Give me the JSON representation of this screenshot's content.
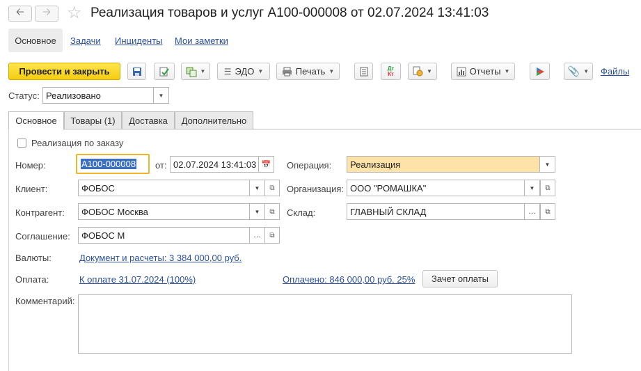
{
  "window": {
    "title": "Реализация товаров и услуг А100-000008 от 02.07.2024 13:41:03"
  },
  "top_nav": {
    "items": [
      {
        "label": "Основное",
        "active": true
      },
      {
        "label": "Задачи"
      },
      {
        "label": "Инциденты"
      },
      {
        "label": "Мои заметки"
      }
    ]
  },
  "toolbar": {
    "post_close": "Провести и закрыть",
    "edo": "ЭДО",
    "print": "Печать",
    "reports": "Отчеты",
    "files": "Файлы",
    "dt_kt_top": "Дт",
    "dt_kt_bottom": "Кт"
  },
  "status": {
    "label": "Статус:",
    "value": "Реализовано"
  },
  "tabs": [
    {
      "label": "Основное",
      "active": true
    },
    {
      "label": "Товары (1)"
    },
    {
      "label": "Доставка"
    },
    {
      "label": "Дополнительно"
    }
  ],
  "form": {
    "by_order_label": "Реализация по заказу",
    "by_order_checked": false,
    "number_label": "Номер:",
    "number_value": "А100-000008",
    "date_label": "от:",
    "date_value": "02.07.2024 13:41:03",
    "operation_label": "Операция:",
    "operation_value": "Реализация",
    "client_label": "Клиент:",
    "client_value": "ФОБОС",
    "organization_label": "Организация:",
    "organization_value": "ООО \"РОМАШКА\"",
    "counterparty_label": "Контрагент:",
    "counterparty_value": "ФОБОС Москва",
    "warehouse_label": "Склад:",
    "warehouse_value": "ГЛАВНЫЙ СКЛАД",
    "agreement_label": "Соглашение:",
    "agreement_value": "ФОБОС М",
    "currencies_label": "Валюты:",
    "currencies_link": "Документ и расчеты: 3 384 000,00 руб.",
    "payment_label": "Оплата:",
    "payment_link": "К оплате 31.07.2024 (100%)",
    "paid_link": "Оплачено: 846 000,00 руб. 25%",
    "offset_button": "Зачет оплаты",
    "comment_label": "Комментарий:",
    "comment_value": ""
  },
  "colors": {
    "primary_button": "#f5cc0f",
    "operation_field": "#fde3a7",
    "link": "#2a4f9e",
    "number_focus": "#f0b429"
  }
}
